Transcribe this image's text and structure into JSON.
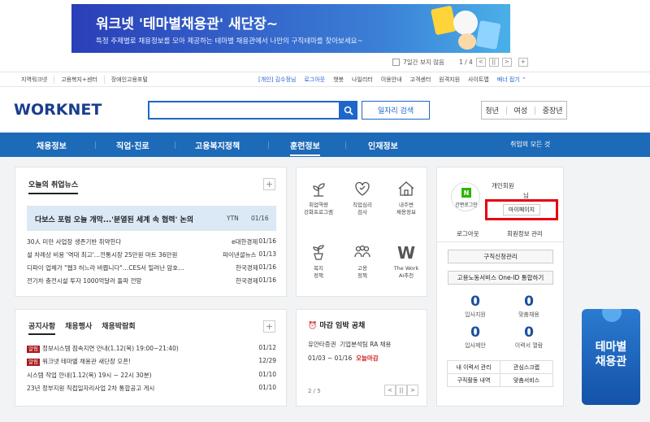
{
  "banner": {
    "title": "워크넷 '테마별채용관' 새단장~",
    "subtitle": "특정 주제별로 채용정보를 모아 제공하는 테마별 채용관에서 나만의 구직테마를 찾아보세요~"
  },
  "banner_pager": {
    "hide_7days": "7일간 보지 않음",
    "page": "1 / 4",
    "prev": "<",
    "pause": "||",
    "next": ">",
    "add": "+"
  },
  "util": {
    "left": [
      "지역워크넷",
      "고용복지+센터",
      "장애인고용포털"
    ],
    "right": {
      "user": "[개인] 김수정님",
      "logout": "로그아웃",
      "chatbot": "챗봇",
      "myservice": "나일리터",
      "guide": "이용안내",
      "center": "고객센터",
      "remote": "원격지원",
      "sitemap": "사이트맵",
      "banner_toggle": "배너 접기"
    }
  },
  "header": {
    "logo": "WORKNET",
    "search_placeholder": "",
    "job_search": "일자리 검색",
    "age": [
      "청년",
      "여성",
      "중장년"
    ]
  },
  "nav": {
    "items": [
      "채용정보",
      "직업·진로",
      "고용복지정책",
      "훈련정보",
      "인재정보"
    ],
    "all": "취업의 모든 것"
  },
  "news": {
    "title": "오늘의 취업뉴스",
    "headline": {
      "text": "다보스 포럼 오늘 개막...'분열된 세계 속 협력' 논의",
      "source": "YTN",
      "date": "01/16"
    },
    "rows": [
      {
        "text": "30人 미만 사업장 생존기반 취약한다",
        "source": "e대한경제",
        "date": "01/16"
      },
      {
        "text": "설 차례상 비용 '역대 최고'…전통시장 25만원 마트 36만원",
        "source": "파이낸셜뉴스",
        "date": "01/13"
      },
      {
        "text": "디파이 업체가 \"웹3 허느라 바쁩니다\"…CES서 밀려난 암호…",
        "source": "한국경제",
        "date": "01/16"
      },
      {
        "text": "전기차 충전시설 투자 1000억달러 돌파 전망",
        "source": "한국경제",
        "date": "01/16"
      }
    ]
  },
  "notice": {
    "tabs": [
      "공지사항",
      "채용행사",
      "채용박람회"
    ],
    "rows": [
      {
        "badge": "알림",
        "text": "정보시스템 점속지연 안내(1.12(목) 19:00~21:40)",
        "date": "01/12"
      },
      {
        "badge": "알림",
        "text": "워크넷 테마별 채용관 새단장 오픈!",
        "date": "12/29"
      },
      {
        "badge": "",
        "text": "시스템 작업 안내(1.12(목) 19시 ~ 22시 30분)",
        "date": "01/10"
      },
      {
        "badge": "",
        "text": "23년 정부지원 직접일자리사업 2차 통합공고 게시",
        "date": "01/10"
      }
    ]
  },
  "icons": [
    {
      "l1": "취업역량",
      "l2": "강화프로그램"
    },
    {
      "l1": "직업심리",
      "l2": "검사"
    },
    {
      "l1": "내주변",
      "l2": "채용정보"
    },
    {
      "l1": "복지",
      "l2": "정책"
    },
    {
      "l1": "고용",
      "l2": "정책"
    },
    {
      "l1": "The Work",
      "l2": "AI추천"
    }
  ],
  "deadline": {
    "title": "마감 임박 공채",
    "company": "유안타증권",
    "position": "기업분석팀 RA 채용",
    "period": "01/03 ~ 01/16",
    "due": "오늘마감",
    "page": "2 / 5"
  },
  "member": {
    "naver_badge": "N",
    "naver_label": "간편로그인",
    "type": "개인회원",
    "name_suffix": "님",
    "mypage": "마이페이지",
    "logout": "로그아웃",
    "edit": "회원정보 관리",
    "job_manage": "구직신청관리",
    "oneid": "고용노동서비스 One-ID 통합하기",
    "counts": [
      {
        "value": "0",
        "label": "입사지원"
      },
      {
        "value": "0",
        "label": "맞춤채용"
      },
      {
        "value": "0",
        "label": "입사제안"
      },
      {
        "value": "0",
        "label": "이력서 열람"
      }
    ],
    "links": [
      "내 이력서 관리",
      "관심스크랩",
      "구직활동 내역",
      "맞춤서비스"
    ]
  },
  "side_banner": {
    "line1": "테마별",
    "line2": "채용관"
  }
}
